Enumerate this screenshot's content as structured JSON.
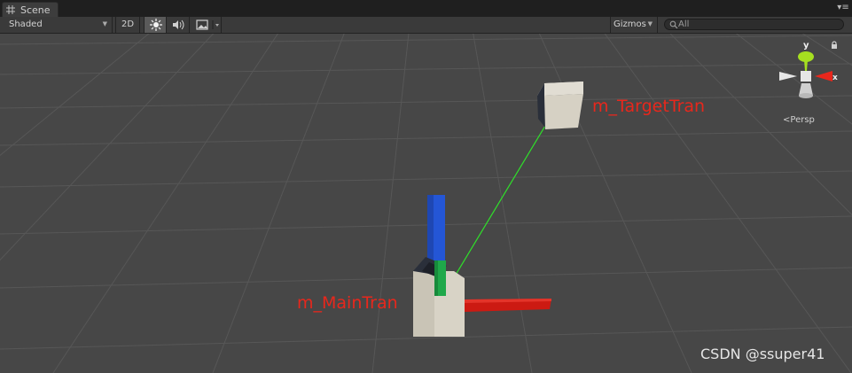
{
  "window": {
    "tab_label": "Scene",
    "tab_icon": "scene-grid-icon",
    "tab_menu_icon": "tab-menu-icon"
  },
  "toolbar": {
    "draw_mode": "Shaded",
    "toggle_2d": "2D",
    "lighting_icon": "sun-icon",
    "audio_icon": "speaker-icon",
    "effects_icon": "image-effects-icon",
    "gizmos_label": "Gizmos",
    "search_placeholder": "All",
    "search_value": ""
  },
  "viewport": {
    "labels": {
      "target": "m_TargetTran",
      "main": "m_MainTran"
    },
    "colors": {
      "label": "#e8271c",
      "line": "#2fe02a",
      "axis_x": "#cc1a12",
      "axis_y": "#1fa84a",
      "axis_z": "#2456d6",
      "cube": "#d8d3c6",
      "grid": "#575757",
      "background": "#474747"
    },
    "orientation_gizmo": {
      "y_label": "y",
      "x_label": "x",
      "projection": "Persp"
    },
    "watermark": "CSDN @ssuper41"
  }
}
